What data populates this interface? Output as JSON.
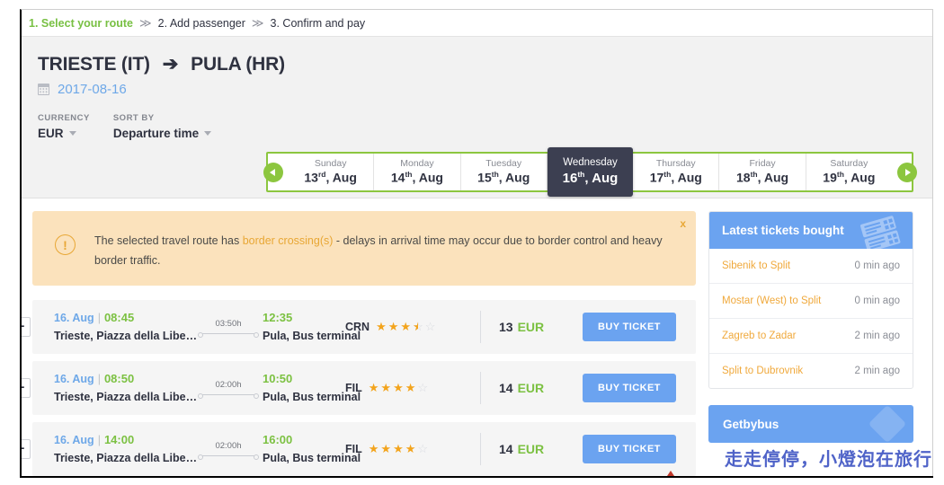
{
  "steps": {
    "items": [
      {
        "label": "1. Select your route",
        "active": true
      },
      {
        "label": "2. Add passenger",
        "active": false
      },
      {
        "label": "3. Confirm and pay",
        "active": false
      }
    ],
    "separator": "≫"
  },
  "header": {
    "origin": "TRIESTE (IT)",
    "arrow": "➔",
    "destination": "PULA (HR)",
    "date": "2017-08-16",
    "currency_label": "CURRENCY",
    "currency_value": "EUR",
    "sort_label": "SORT BY",
    "sort_value": "Departure time"
  },
  "datestrip": {
    "prev_label": "◀",
    "next_label": "▶",
    "days": [
      {
        "dow": "Sunday",
        "num": "13",
        "ord": "rd",
        "month": ", Aug",
        "selected": false
      },
      {
        "dow": "Monday",
        "num": "14",
        "ord": "th",
        "month": ", Aug",
        "selected": false
      },
      {
        "dow": "Tuesday",
        "num": "15",
        "ord": "th",
        "month": ", Aug",
        "selected": false
      },
      {
        "dow": "Wednesday",
        "num": "16",
        "ord": "th",
        "month": ", Aug",
        "selected": true
      },
      {
        "dow": "Thursday",
        "num": "17",
        "ord": "th",
        "month": ", Aug",
        "selected": false
      },
      {
        "dow": "Friday",
        "num": "18",
        "ord": "th",
        "month": ", Aug",
        "selected": false
      },
      {
        "dow": "Saturday",
        "num": "19",
        "ord": "th",
        "month": ", Aug",
        "selected": false
      }
    ]
  },
  "alert": {
    "icon": "!",
    "text_before": "The selected travel route has ",
    "highlight": "border crossing(s)",
    "text_after": " - delays in arrival time may occur due to border control and heavy border traffic.",
    "close_label": "x"
  },
  "results": [
    {
      "expander": "+",
      "dep_date": "16. Aug",
      "pipe": "|",
      "dep_time": "08:45",
      "dep_stop": "Trieste, Piazza della Libe…",
      "duration": "03:50h",
      "arr_time": "12:35",
      "arr_stop": "Pula, Bus terminal",
      "operator": "CRN",
      "rating": 3.5,
      "price": "13",
      "currency": "EUR",
      "buy_label": "BUY TICKET"
    },
    {
      "expander": "+",
      "dep_date": "16. Aug",
      "pipe": "|",
      "dep_time": "08:50",
      "dep_stop": "Trieste, Piazza della Libe…",
      "duration": "02:00h",
      "arr_time": "10:50",
      "arr_stop": "Pula, Bus terminal",
      "operator": "FIL",
      "rating": 4,
      "price": "14",
      "currency": "EUR",
      "buy_label": "BUY TICKET"
    },
    {
      "expander": "+",
      "dep_date": "16. Aug",
      "pipe": "|",
      "dep_time": "14:00",
      "dep_stop": "Trieste, Piazza della Libe…",
      "duration": "02:00h",
      "arr_time": "16:00",
      "arr_stop": "Pula, Bus terminal",
      "operator": "FIL",
      "rating": 4,
      "price": "14",
      "currency": "EUR",
      "buy_label": "BUY TICKET"
    }
  ],
  "sidebar": {
    "latest": {
      "title": "Latest tickets bought",
      "items": [
        {
          "route": "Sibenik to Split",
          "ago": "0 min ago"
        },
        {
          "route": "Mostar (West) to Split",
          "ago": "0 min ago"
        },
        {
          "route": "Zagreb to Zadar",
          "ago": "2 min ago"
        },
        {
          "route": "Split to Dubrovnik",
          "ago": "2 min ago"
        }
      ]
    },
    "promo": {
      "label": "Getbybus"
    }
  },
  "watermark": {
    "text": "走走停停，小燈泡在旅行"
  },
  "colors": {
    "green": "#8cc63f",
    "blue": "#6ba3f0",
    "orange": "#f0a93c",
    "dark": "#3c3f51",
    "alert_bg": "#fbe2bc"
  }
}
